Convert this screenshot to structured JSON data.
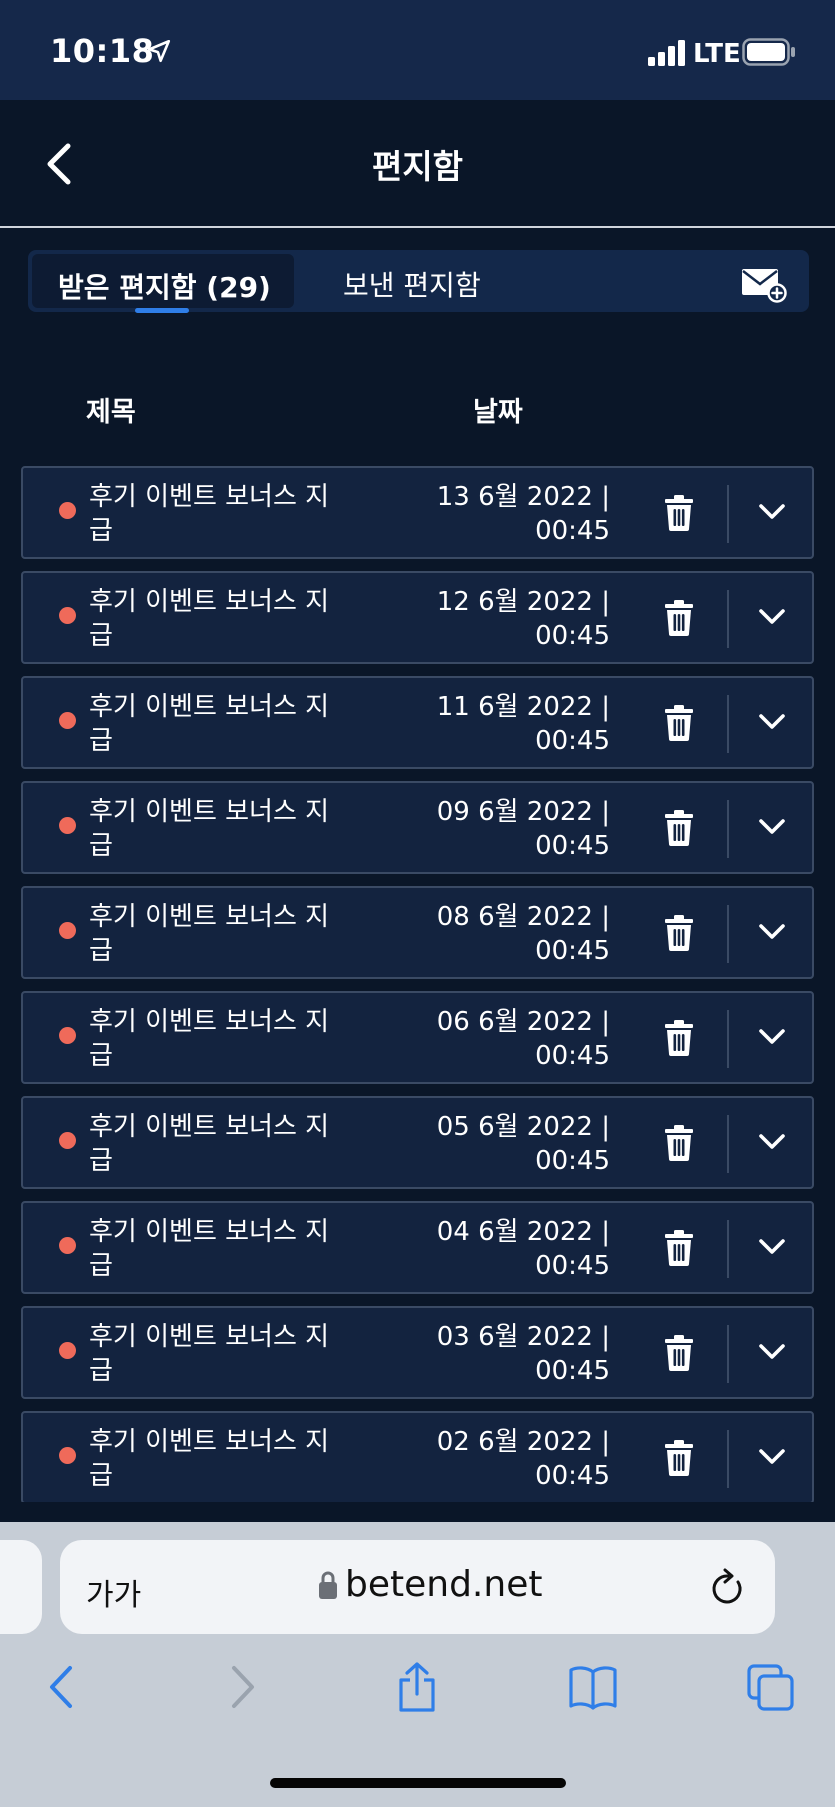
{
  "status_bar": {
    "time": "10:18",
    "network": "LTE"
  },
  "header": {
    "title": "편지함"
  },
  "tabs": {
    "inbox_label": "받은 편지함 (29)",
    "sent_label": "보낸 편지함"
  },
  "columns": {
    "subject": "제목",
    "date": "날짜"
  },
  "colors": {
    "unread_dot": "#ef6a5a",
    "tab_indicator": "#2f7ee8",
    "accent_blue": "#2f7ee8"
  },
  "messages": [
    {
      "subject": "후기 이벤트 보너스 지급",
      "date": "13 6월 2022 |",
      "time": "00:45",
      "unread": true
    },
    {
      "subject": "후기 이벤트 보너스 지급",
      "date": "12 6월 2022 |",
      "time": "00:45",
      "unread": true
    },
    {
      "subject": "후기 이벤트 보너스 지급",
      "date": "11 6월 2022 |",
      "time": "00:45",
      "unread": true
    },
    {
      "subject": "후기 이벤트 보너스 지급",
      "date": "09 6월 2022 |",
      "time": "00:45",
      "unread": true
    },
    {
      "subject": "후기 이벤트 보너스 지급",
      "date": "08 6월 2022 |",
      "time": "00:45",
      "unread": true
    },
    {
      "subject": "후기 이벤트 보너스 지급",
      "date": "06 6월 2022 |",
      "time": "00:45",
      "unread": true
    },
    {
      "subject": "후기 이벤트 보너스 지급",
      "date": "05 6월 2022 |",
      "time": "00:45",
      "unread": true
    },
    {
      "subject": "후기 이벤트 보너스 지급",
      "date": "04 6월 2022 |",
      "time": "00:45",
      "unread": true
    },
    {
      "subject": "후기 이벤트 보너스 지급",
      "date": "03 6월 2022 |",
      "time": "00:45",
      "unread": true
    },
    {
      "subject": "후기 이벤트 보너스 지급",
      "date": "02 6월 2022 |",
      "time": "00:45",
      "unread": true
    }
  ],
  "browser": {
    "text_size_label": "가가",
    "url": "betend.net"
  }
}
